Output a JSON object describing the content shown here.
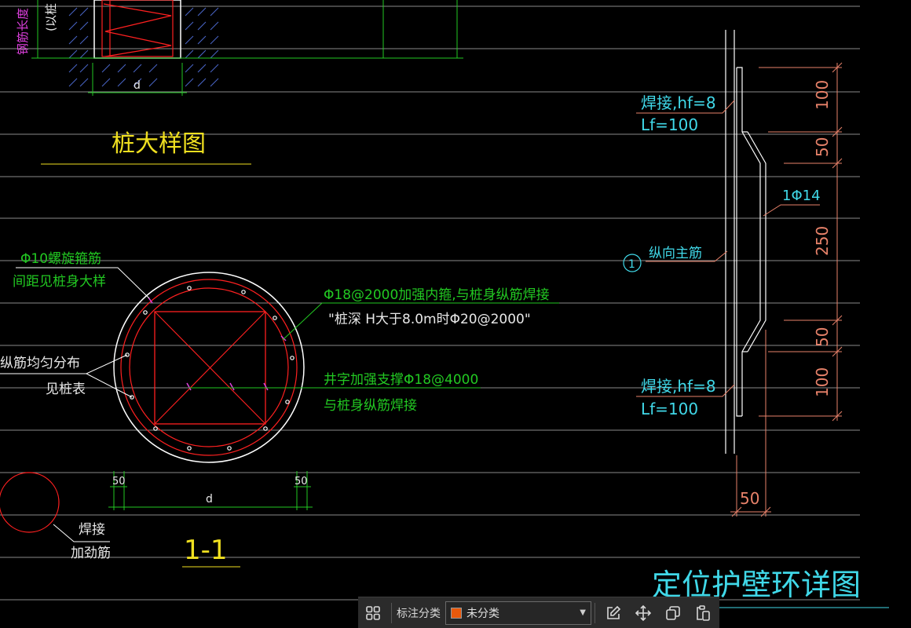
{
  "drawing": {
    "pile_detail_title": "桩大样图",
    "top_vertical_label_1": "钢筋长度",
    "top_vertical_label_2": "(以桩",
    "dim_d_top": "d",
    "section_title": "1-1",
    "spiral_note_1": "Φ10螺旋箍筋",
    "spiral_note_2": "间距见桩身大样",
    "long_bar_note_1": "纵筋均匀分布",
    "long_bar_note_2": "见桩表",
    "stiffener_note_1": "Φ18@2000加强内箍,与桩身纵筋焊接",
    "stiffener_note_2": "\"桩深 H大于8.0m时Φ20@2000\"",
    "cross_brace_note_1": "井字加强支撑Φ18@4000",
    "cross_brace_note_2": "与桩身纵筋焊接",
    "dim_50_left": "50",
    "dim_50_right": "50",
    "dim_d_bottom": "d",
    "weld_note_1": "焊接",
    "weld_note_2": "加劲筋",
    "ring_title": "定位护壁环详图",
    "weld_top_1": "焊接,hf=8",
    "weld_top_2": "Lf=100",
    "weld_bottom_1": "焊接,hf=8",
    "weld_bottom_2": "Lf=100",
    "bar_label": "1Φ14",
    "main_bar_label": "纵向主筋",
    "circle_marker": "1",
    "dim_100_top": "100",
    "dim_50_upper": "50",
    "dim_250": "250",
    "dim_50_lower": "50",
    "dim_100_bottom": "100",
    "dim_50_bottom": "50"
  },
  "toolbar": {
    "grid_icon": "grid-icon",
    "category_label": "标注分类",
    "category_value": "未分类",
    "category_color": "#e8590c",
    "edit_icon": "edit-icon",
    "move_icon": "move-icon",
    "copy_icon": "copy-icon",
    "paste_icon": "paste-icon"
  }
}
